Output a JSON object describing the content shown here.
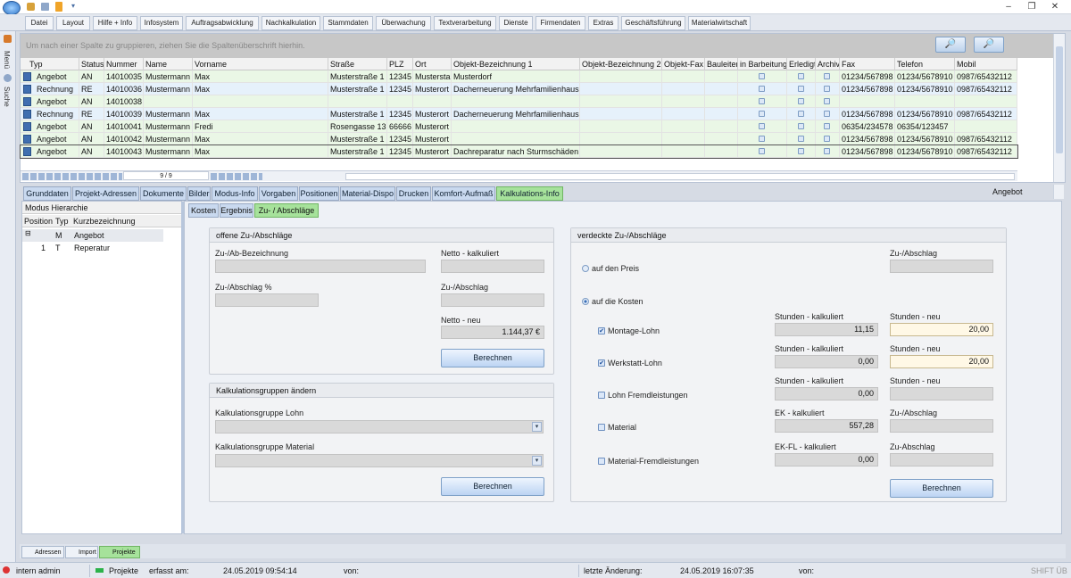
{
  "menu": [
    "Datei",
    "Layout",
    "Hilfe + Info",
    "Infosystem",
    "Auftragsabwicklung",
    "Nachkalkulation",
    "Stammdaten",
    "Überwachung",
    "Textverarbeitung",
    "Dienste",
    "Firmendaten",
    "Extras",
    "Geschäftsführung",
    "Materialwirtschaft"
  ],
  "sidebar": {
    "menu_label": "Menü",
    "search_label": "Suche"
  },
  "grid": {
    "group_hint": "Um nach einer Spalte zu gruppieren, ziehen Sie die Spaltenüberschrift hierhin.",
    "columns": [
      "Typ",
      "Status",
      "Nummer",
      "Name",
      "Vorname",
      "Straße",
      "PLZ",
      "Ort",
      "Objekt-Bezeichnung 1",
      "Objekt-Bezeichnung 2",
      "Objekt-Fax",
      "Bauleiter",
      "in Barbeitung",
      "Erledigt",
      "Archiv",
      "Fax",
      "Telefon",
      "Mobil"
    ],
    "rows": [
      {
        "typ": "Angebot",
        "status": "AN",
        "nr": "14010035",
        "name": "Mustermann",
        "vorname": "Max",
        "strasse": "Musterstraße 1",
        "plz": "12345",
        "ort": "Mustersta",
        "obj1": "Musterdorf",
        "fax": "01234/567898",
        "tel": "01234/5678910",
        "mobil": "0987/65432112",
        "checks": true
      },
      {
        "typ": "Rechnung",
        "status": "RE",
        "nr": "14010036",
        "name": "Mustermann",
        "vorname": "Max",
        "strasse": "Musterstraße 1",
        "plz": "12345",
        "ort": "Musterort",
        "obj1": "Dacherneuerung Mehrfamilienhaus",
        "fax": "01234/567898",
        "tel": "01234/5678910",
        "mobil": "0987/65432112",
        "checks": true
      },
      {
        "typ": "Angebot",
        "status": "AN",
        "nr": "14010038",
        "name": "",
        "vorname": "",
        "strasse": "",
        "plz": "",
        "ort": "",
        "obj1": "",
        "fax": "",
        "tel": "",
        "mobil": "",
        "checks": true
      },
      {
        "typ": "Rechnung",
        "status": "RE",
        "nr": "14010039",
        "name": "Mustermann",
        "vorname": "Max",
        "strasse": "Musterstraße 1",
        "plz": "12345",
        "ort": "Musterort",
        "obj1": "Dacherneuerung Mehrfamilienhaus",
        "fax": "01234/567898",
        "tel": "01234/5678910",
        "mobil": "0987/65432112",
        "checks": true
      },
      {
        "typ": "Angebot",
        "status": "AN",
        "nr": "14010041",
        "name": "Mustermann",
        "vorname": "Fredi",
        "strasse": "Rosengasse 13",
        "plz": "66666",
        "ort": "Musterort",
        "obj1": "",
        "fax": "06354/234578",
        "tel": "06354/123457",
        "mobil": "",
        "checks": true
      },
      {
        "typ": "Angebot",
        "status": "AN",
        "nr": "14010042",
        "name": "Mustermann",
        "vorname": "Max",
        "strasse": "Musterstraße 1",
        "plz": "12345",
        "ort": "Musterort",
        "obj1": "",
        "fax": "01234/567898",
        "tel": "01234/5678910",
        "mobil": "0987/65432112",
        "checks": true
      },
      {
        "typ": "Angebot",
        "status": "AN",
        "nr": "14010043",
        "name": "Mustermann",
        "vorname": "Max",
        "strasse": "Musterstraße 1",
        "plz": "12345",
        "ort": "Musterort",
        "obj1": "Dachreparatur nach Sturmschäden",
        "fax": "01234/567898",
        "tel": "01234/5678910",
        "mobil": "0987/65432112",
        "checks": true
      }
    ],
    "record_nav": "9 / 9"
  },
  "detail_tabs": [
    "Grunddaten",
    "Projekt-Adressen",
    "Dokumente",
    "Bilder",
    "Modus-Info",
    "Vorgaben",
    "Positionen",
    "Material-Dispo",
    "Drucken",
    "Komfort-Aufmaß",
    "Kalkulations-Info"
  ],
  "detail_context": "Angebot",
  "hierarchy": {
    "title": "Modus Hierarchie",
    "columns": [
      "Position",
      "Typ",
      "Kurzbezeichnung"
    ],
    "rows": [
      {
        "pos": "",
        "typ": "M",
        "bez": "Angebot"
      },
      {
        "pos": "1",
        "typ": "T",
        "bez": "Reperatur"
      }
    ]
  },
  "sub_tabs": [
    "Kosten",
    "Ergebnis",
    "Zu- / Abschläge"
  ],
  "offene": {
    "title": "offene Zu-/Abschläge",
    "bez_label": "Zu-/Ab-Bezeichnung",
    "netto_kalk_label": "Netto - kalkuliert",
    "pct_label": "Zu-/Abschlag %",
    "zuab_label": "Zu-/Abschlag",
    "netto_neu_label": "Netto - neu",
    "netto_neu_value": "1.144,37 €",
    "button": "Berechnen"
  },
  "kgruppen": {
    "title": "Kalkulationsgruppen ändern",
    "lohn_label": "Kalkulationsgruppe Lohn",
    "material_label": "Kalkulationsgruppe Material",
    "button": "Berechnen"
  },
  "verdeckte": {
    "title": "verdeckte Zu-/Abschläge",
    "zuab_label": "Zu-/Abschlag",
    "radio_preis": "auf den Preis",
    "radio_kosten": "auf die Kosten",
    "items": [
      {
        "label": "Montage-Lohn",
        "checked": true,
        "l1": "Stunden - kalkuliert",
        "v1": "11,15",
        "l2": "Stunden - neu",
        "v2": "20,00",
        "edit": true
      },
      {
        "label": "Werkstatt-Lohn",
        "checked": true,
        "l1": "Stunden - kalkuliert",
        "v1": "0,00",
        "l2": "Stunden - neu",
        "v2": "20,00",
        "edit": true
      },
      {
        "label": "Lohn Fremdleistungen",
        "checked": false,
        "l1": "Stunden - kalkuliert",
        "v1": "0,00",
        "l2": "Stunden - neu",
        "v2": "",
        "edit": false
      },
      {
        "label": "Material",
        "checked": false,
        "l1": "EK - kalkuliert",
        "v1": "557,28",
        "l2": "Zu-/Abschlag",
        "v2": "",
        "edit": false
      },
      {
        "label": "Material-Fremdleistungen",
        "checked": false,
        "l1": "EK-FL - kalkuliert",
        "v1": "0,00",
        "l2": "Zu-Abschlag",
        "v2": "",
        "edit": false
      }
    ],
    "button": "Berechnen"
  },
  "bottom_tabs": [
    "Adressen",
    "Import",
    "Projekte"
  ],
  "status": {
    "user": "intern admin",
    "module": "Projekte",
    "erfasst_label": "erfasst am:",
    "erfasst_value": "24.05.2019 09:54:14",
    "von1": "von:",
    "aenderung_label": "letzte Änderung:",
    "aenderung_value": "24.05.2019 16:07:35",
    "von2": "von:",
    "keys": "SHIFT ÜB"
  },
  "colors": {
    "accent_green": "#a6e29b",
    "tab_blue": "#c9d9ef",
    "row_green": "#eaf7e6",
    "row_blue": "#e6f1fb"
  }
}
